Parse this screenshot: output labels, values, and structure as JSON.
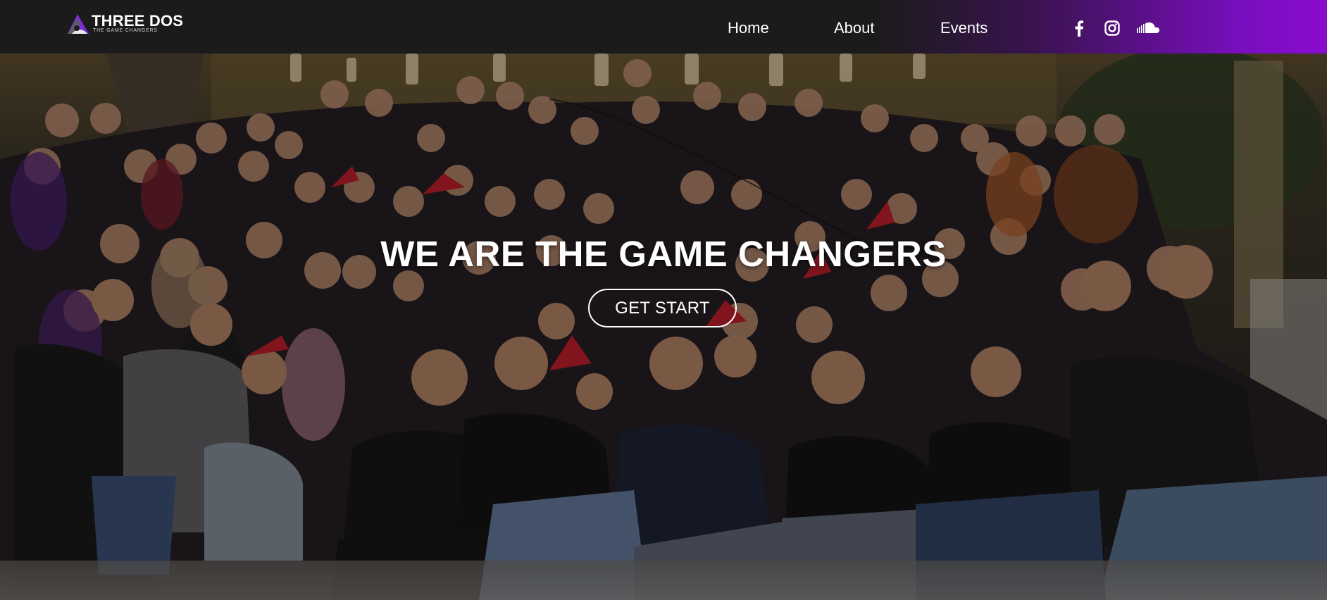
{
  "brand": {
    "name": "THREE DOS",
    "tagline": "THE GAME CHANGERS",
    "logo_colors": [
      "#8a2be2",
      "#5a5a5a",
      "#ffffff"
    ]
  },
  "nav": {
    "items": [
      {
        "label": "Home"
      },
      {
        "label": "About"
      },
      {
        "label": "Events"
      }
    ]
  },
  "social": {
    "icons": [
      "facebook-icon",
      "instagram-icon",
      "soundcloud-icon"
    ]
  },
  "hero": {
    "title": "WE ARE THE GAME CHANGERS",
    "button_label": "GET START",
    "image": "group-photo"
  },
  "colors": {
    "nav_bg": "#1b1b1b",
    "nav_accent": "#8a0ccf",
    "text": "#ffffff"
  }
}
